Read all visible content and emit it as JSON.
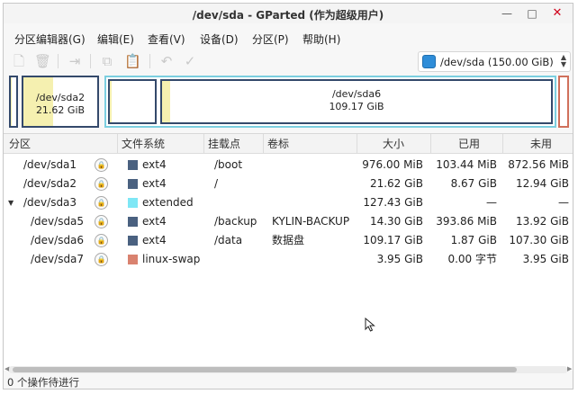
{
  "window": {
    "title": "/dev/sda - GParted (作为超级用户)",
    "controls": {
      "minimize": "—",
      "maximize": "□",
      "close": "✕"
    }
  },
  "menu": [
    "分区编辑器(G)",
    "编辑(E)",
    "查看(V)",
    "设备(D)",
    "分区(P)",
    "帮助(H)"
  ],
  "toolbar": {
    "icons": [
      "new-icon",
      "delete-icon",
      "resize-move-icon",
      "copy-icon",
      "paste-icon",
      "undo-icon",
      "apply-icon"
    ],
    "device_label": "/dev/sda   (150.00 GiB)",
    "device_arrows": "▲▼"
  },
  "graph": [
    {
      "name": "/dev/sda1",
      "label": "",
      "size": "",
      "used_fraction": 0.11,
      "color": "#34496b"
    },
    {
      "name": "/dev/sda2",
      "label": "/dev/sda2",
      "size": "21.62 GiB",
      "used_fraction": 0.4,
      "color": "#34496b"
    },
    {
      "name": "/dev/sda5",
      "label": "",
      "size": "",
      "used_fraction": 0.03,
      "color": "#34496b"
    },
    {
      "name": "/dev/sda6",
      "label": "/dev/sda6",
      "size": "109.17 GiB",
      "used_fraction": 0.02,
      "color": "#34496b"
    },
    {
      "name": "/dev/sda7",
      "label": "",
      "size": "",
      "used_fraction": 0.0,
      "color": "#d0705b"
    }
  ],
  "table": {
    "headers": [
      "分区",
      "文件系统",
      "挂载点",
      "卷标",
      "大小",
      "已用",
      "未用"
    ],
    "rows": [
      {
        "partition": "/dev/sda1",
        "fs": "ext4",
        "fs_color": "#4a6180",
        "mount": "/boot",
        "label": "",
        "size": "976.00 MiB",
        "used": "103.44 MiB",
        "unused": "872.56 MiB",
        "indent": 0,
        "expander": ""
      },
      {
        "partition": "/dev/sda2",
        "fs": "ext4",
        "fs_color": "#4a6180",
        "mount": "/",
        "label": "",
        "size": "21.62 GiB",
        "used": "8.67 GiB",
        "unused": "12.94 GiB",
        "indent": 0,
        "expander": ""
      },
      {
        "partition": "/dev/sda3",
        "fs": "extended",
        "fs_color": "#7ee7f5",
        "mount": "",
        "label": "",
        "size": "127.43 GiB",
        "used": "—",
        "unused": "—",
        "indent": 0,
        "expander": "▼"
      },
      {
        "partition": "/dev/sda5",
        "fs": "ext4",
        "fs_color": "#4a6180",
        "mount": "/backup",
        "label": "KYLIN-BACKUP",
        "size": "14.30 GiB",
        "used": "393.86 MiB",
        "unused": "13.92 GiB",
        "indent": 1,
        "expander": ""
      },
      {
        "partition": "/dev/sda6",
        "fs": "ext4",
        "fs_color": "#4a6180",
        "mount": "/data",
        "label": "数据盘",
        "size": "109.17 GiB",
        "used": "1.87 GiB",
        "unused": "107.30 GiB",
        "indent": 1,
        "expander": ""
      },
      {
        "partition": "/dev/sda7",
        "fs": "linux-swap",
        "fs_color": "#d9826f",
        "mount": "",
        "label": "",
        "size": "3.95 GiB",
        "used": "0.00 字节",
        "unused": "3.95 GiB",
        "indent": 1,
        "expander": ""
      }
    ]
  },
  "status": "0 个操作待进行"
}
